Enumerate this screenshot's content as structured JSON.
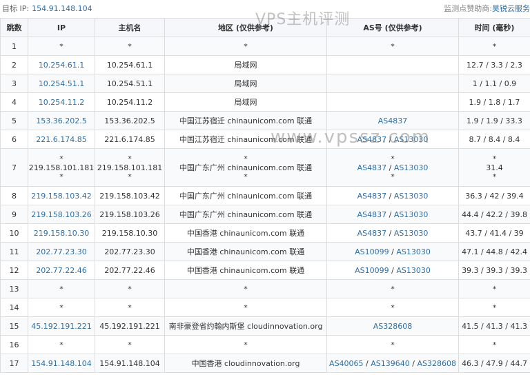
{
  "header": {
    "target_label": "目标 IP:",
    "target_ip": "154.91.148.104",
    "sponsor_label": "监测点赞助商:",
    "sponsor_name": "昊锐云服务"
  },
  "watermarks": {
    "title": "VPS主机评测",
    "site": "www.vpssz.com"
  },
  "columns": [
    "跳数",
    "IP",
    "主机名",
    "地区 (仅供参考)",
    "AS号 (仅供参考)",
    "时间 (毫秒)"
  ],
  "rows": [
    {
      "hop": "1",
      "ip": "*",
      "host": "*",
      "region": "*",
      "as": [],
      "as_text": "*",
      "time": "*"
    },
    {
      "hop": "2",
      "ip": "10.254.61.1",
      "host": "10.254.61.1",
      "region": "局域网",
      "as": [],
      "as_text": "",
      "time": "12.7 / 3.3 / 2.3"
    },
    {
      "hop": "3",
      "ip": "10.254.51.1",
      "host": "10.254.51.1",
      "region": "局域网",
      "as": [],
      "as_text": "",
      "time": "1 / 1.1 / 0.9"
    },
    {
      "hop": "4",
      "ip": "10.254.11.2",
      "host": "10.254.11.2",
      "region": "局域网",
      "as": [],
      "as_text": "",
      "time": "1.9 / 1.8 / 1.7"
    },
    {
      "hop": "5",
      "ip": "153.36.202.5",
      "host": "153.36.202.5",
      "region": "中国江苏宿迁 chinaunicom.com 联通",
      "as": [
        "AS4837"
      ],
      "as_text": "",
      "time": "1.9 / 1.9 / 33.3"
    },
    {
      "hop": "6",
      "ip": "221.6.174.85",
      "host": "221.6.174.85",
      "region": "中国江苏宿迁 chinaunicom.com 联通",
      "as": [
        "AS4837",
        "AS13030"
      ],
      "as_text": "",
      "time": "8.7 / 8.4 / 8.4"
    },
    {
      "hop": "7",
      "ip": "219.158.101.181",
      "host": "219.158.101.181",
      "region": "中国广东广州 chinaunicom.com 联通",
      "as": [
        "AS4837",
        "AS13030"
      ],
      "as_text": "",
      "time": "31.4",
      "tall": true
    },
    {
      "hop": "8",
      "ip": "219.158.103.42",
      "host": "219.158.103.42",
      "region": "中国广东广州 chinaunicom.com 联通",
      "as": [
        "AS4837",
        "AS13030"
      ],
      "as_text": "",
      "time": "36.3 / 42 / 39.4"
    },
    {
      "hop": "9",
      "ip": "219.158.103.26",
      "host": "219.158.103.26",
      "region": "中国广东广州 chinaunicom.com 联通",
      "as": [
        "AS4837",
        "AS13030"
      ],
      "as_text": "",
      "time": "44.4 / 42.2 / 39.8"
    },
    {
      "hop": "10",
      "ip": "219.158.10.30",
      "host": "219.158.10.30",
      "region": "中国香港 chinaunicom.com 联通",
      "as": [
        "AS4837",
        "AS13030"
      ],
      "as_text": "",
      "time": "43.7 / 41.4 / 39"
    },
    {
      "hop": "11",
      "ip": "202.77.23.30",
      "host": "202.77.23.30",
      "region": "中国香港 chinaunicom.com 联通",
      "as": [
        "AS10099",
        "AS13030"
      ],
      "as_text": "",
      "time": "47.1 / 44.8 / 42.4"
    },
    {
      "hop": "12",
      "ip": "202.77.22.46",
      "host": "202.77.22.46",
      "region": "中国香港 chinaunicom.com 联通",
      "as": [
        "AS10099",
        "AS13030"
      ],
      "as_text": "",
      "time": "39.3 / 39.3 / 39.3"
    },
    {
      "hop": "13",
      "ip": "*",
      "host": "*",
      "region": "*",
      "as": [],
      "as_text": "*",
      "time": "*"
    },
    {
      "hop": "14",
      "ip": "*",
      "host": "*",
      "region": "*",
      "as": [],
      "as_text": "*",
      "time": "*"
    },
    {
      "hop": "15",
      "ip": "45.192.191.221",
      "host": "45.192.191.221",
      "region": "南非豪登省约翰内斯堡 cloudinnovation.org",
      "as": [
        "AS328608"
      ],
      "as_text": "",
      "time": "41.5 / 41.3 / 41.3"
    },
    {
      "hop": "16",
      "ip": "*",
      "host": "*",
      "region": "*",
      "as": [],
      "as_text": "*",
      "time": "*"
    },
    {
      "hop": "17",
      "ip": "154.91.148.104",
      "host": "154.91.148.104",
      "region": "中国香港 cloudinnovation.org",
      "as": [
        "AS40065",
        "AS139640",
        "AS328608"
      ],
      "as_text": "",
      "time": "46.3 / 47.9 / 44.7"
    }
  ]
}
